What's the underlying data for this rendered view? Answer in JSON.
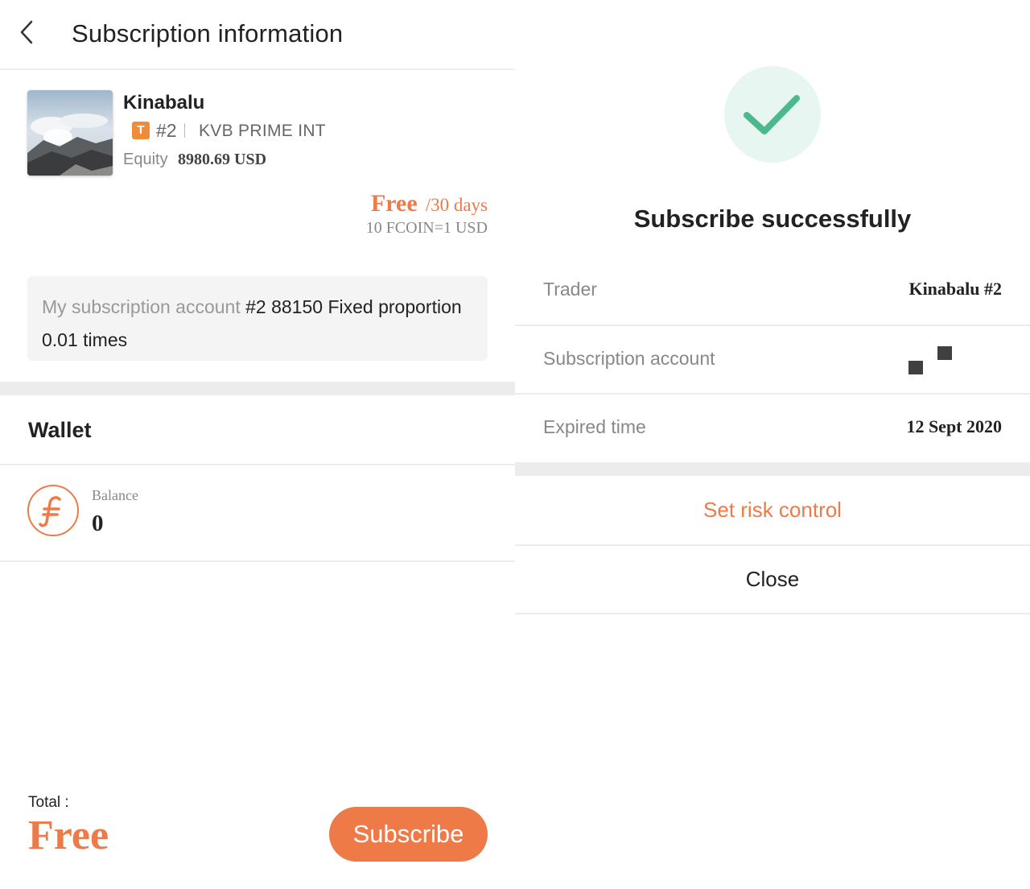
{
  "left": {
    "title": "Subscription information",
    "trader": {
      "name": "Kinabalu",
      "badge": "T",
      "number": "#2",
      "broker": "KVB PRIME INT",
      "equity_label": "Equity",
      "equity_value": "8980.69 USD"
    },
    "price": {
      "amount": "Free",
      "period": "/30 days",
      "rate": "10 FCOIN=1 USD"
    },
    "account": {
      "label": "My subscription account",
      "value": "#2 88150 Fixed proportion 0.01 times"
    },
    "wallet": {
      "title": "Wallet",
      "icon": "fcoin-icon",
      "balance_label": "Balance",
      "balance_value": "0"
    },
    "footer": {
      "total_label": "Total :",
      "total_value": "Free",
      "subscribe_label": "Subscribe"
    }
  },
  "right": {
    "success_icon": "checkmark-icon",
    "title": "Subscribe successfully",
    "rows": [
      {
        "label": "Trader",
        "value": "Kinabalu #2"
      },
      {
        "label": "Subscription account",
        "value": ""
      },
      {
        "label": "Expired time",
        "value": "12 Sept 2020"
      }
    ],
    "actions": {
      "risk_label": "Set risk control",
      "close_label": "Close"
    }
  },
  "colors": {
    "accent": "#ee7a47",
    "badge": "#ef8c3c",
    "success": "#4cb98c",
    "success_bg": "#e8f6f1",
    "divider": "#ececec",
    "muted": "#888888"
  }
}
